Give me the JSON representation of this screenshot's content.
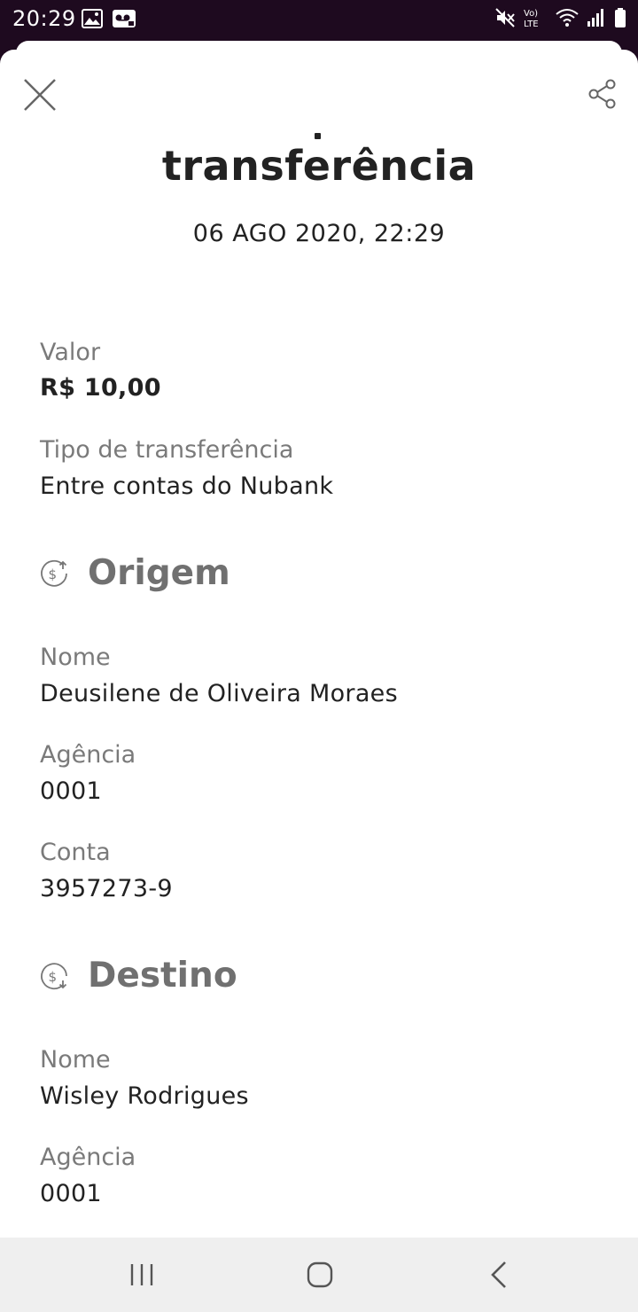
{
  "status_bar": {
    "time": "20:29",
    "left_icons": [
      "image-icon",
      "voicemail-icon"
    ],
    "right_icons": [
      "mute-icon",
      "volte-icon",
      "wifi-icon",
      "signal-icon",
      "battery-icon"
    ],
    "volte_label": "Vo) LTE"
  },
  "header": {
    "close_icon": "close-icon",
    "share_icon": "share-icon",
    "title": "transferência",
    "date": "06 AGO 2020, 22:29"
  },
  "transfer": {
    "valor_label": "Valor",
    "valor_value": "R$ 10,00",
    "tipo_label": "Tipo de transferência",
    "tipo_value": "Entre contas do Nubank"
  },
  "origem": {
    "title": "Origem",
    "icon": "money-up-icon",
    "nome_label": "Nome",
    "nome_value": "Deusilene de Oliveira Moraes",
    "agencia_label": "Agência",
    "agencia_value": "0001",
    "conta_label": "Conta",
    "conta_value": "3957273-9"
  },
  "destino": {
    "title": "Destino",
    "icon": "money-down-icon",
    "nome_label": "Nome",
    "nome_value": "Wisley Rodrigues",
    "agencia_label": "Agência",
    "agencia_value": "0001"
  },
  "nav_bar": {
    "buttons": [
      "recent-apps-icon",
      "home-icon",
      "back-icon"
    ]
  },
  "colors": {
    "status_bg": "#1e0a1f",
    "text_primary": "#222222",
    "text_secondary": "#7a7a7a",
    "section_title": "#707070",
    "nav_bg": "#efefef"
  }
}
